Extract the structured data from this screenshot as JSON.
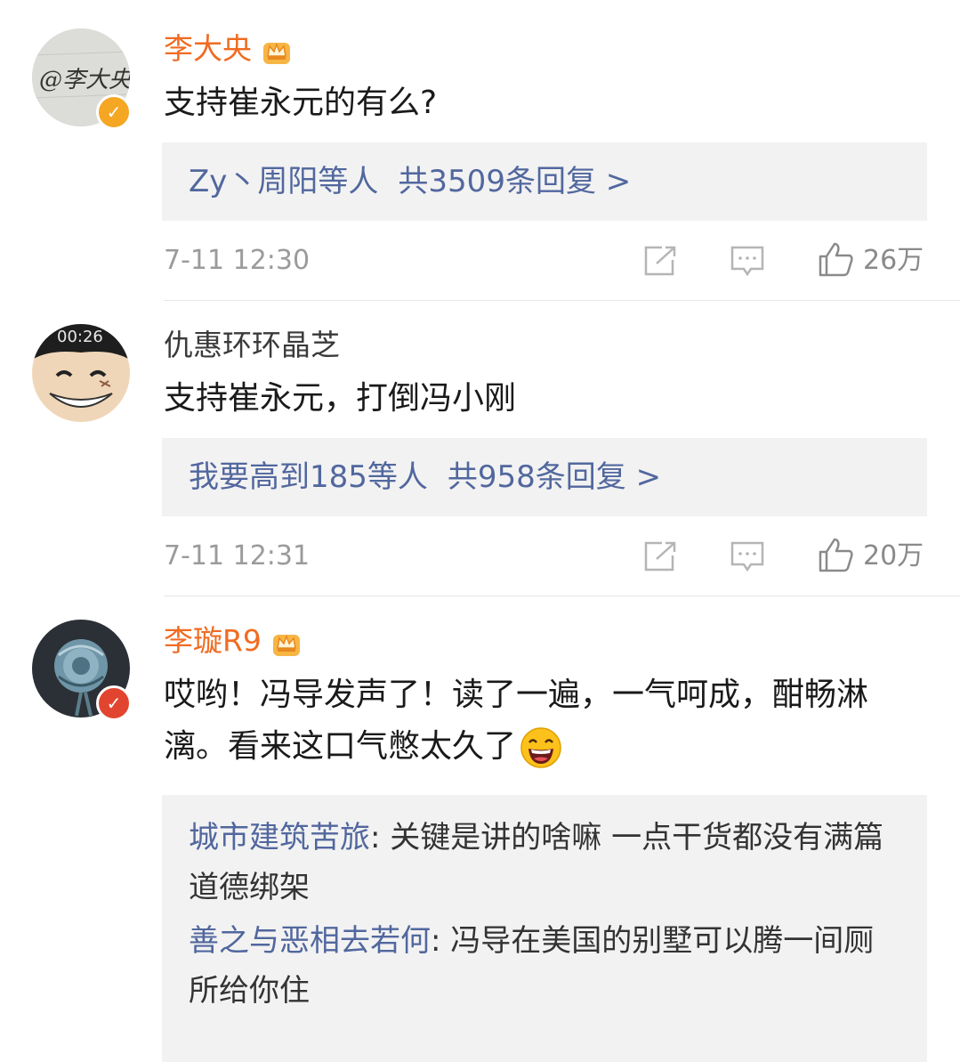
{
  "comments": [
    {
      "username": "李大央",
      "text": "支持崔永元的有么?",
      "replies_preview": "Zy丶周阳等人",
      "replies_total": "共3509条回复 >",
      "time": "7-11 12:30",
      "likes": "26万",
      "avatar_text": "@李大央"
    },
    {
      "username": "仇惠环环晶芝",
      "text": "支持崔永元，打倒冯小刚",
      "replies_preview": "我要高到185等人",
      "replies_total": "共958条回复 >",
      "time": "7-11 12:31",
      "likes": "20万",
      "avatar_text": "00:26"
    },
    {
      "username": "李璇R9",
      "text": "哎哟！冯导发声了！读了一遍，一气呵成，酣畅淋漓。看来这口气憋太久了",
      "sub_replies": [
        {
          "user": "城市建筑苦旅",
          "sep": ": ",
          "text": "关键是讲的啥嘛 一点干货都没有满篇道德绑架"
        },
        {
          "user": "善之与恶相去若何",
          "sep": ": ",
          "text": "冯导在美国的别墅可以腾一间厕所给你住"
        }
      ]
    }
  ],
  "colors": {
    "vip_name": "#f06b21",
    "link": "#51679e",
    "box": "#f2f2f2"
  },
  "icons": [
    "crown-icon",
    "verified-badge-icon",
    "share-icon",
    "comment-icon",
    "like-icon",
    "laughing-emoji-icon"
  ]
}
